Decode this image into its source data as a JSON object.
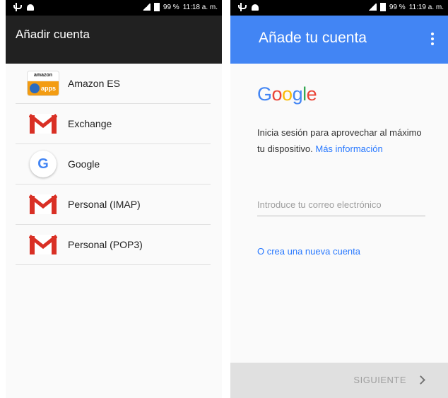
{
  "left": {
    "status": {
      "battery": "99 %",
      "time": "11:18 a. m."
    },
    "title": "Añadir cuenta",
    "items": [
      {
        "label": "Amazon ES",
        "icon": "amazon-apps-icon",
        "icon_text_top": "amazon",
        "icon_text_bottom": "apps"
      },
      {
        "label": "Exchange",
        "icon": "gmail-icon"
      },
      {
        "label": "Google",
        "icon": "google-icon",
        "icon_text": "G"
      },
      {
        "label": "Personal (IMAP)",
        "icon": "gmail-icon"
      },
      {
        "label": "Personal (POP3)",
        "icon": "gmail-icon"
      }
    ]
  },
  "right": {
    "status": {
      "battery": "99 %",
      "time": "11:19 a. m."
    },
    "title": "Añade tu cuenta",
    "logo": "Google",
    "prompt": "Inicia sesión para aprovechar al máximo tu dispositivo. ",
    "prompt_link": "Más información",
    "email_placeholder": "Introduce tu correo electrónico",
    "create_account": "O crea una nueva cuenta",
    "next": "SIGUIENTE"
  },
  "colors": {
    "accent": "#4285f4",
    "appbar_dark": "#212121",
    "link": "#2979ff"
  }
}
